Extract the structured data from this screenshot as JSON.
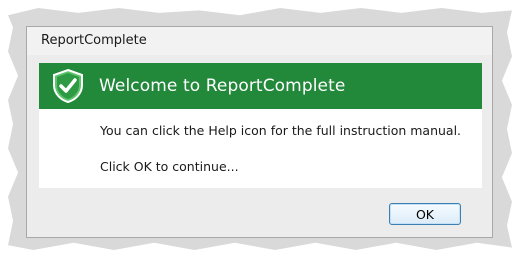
{
  "window": {
    "title": "ReportComplete"
  },
  "banner": {
    "icon": "shield-check-icon",
    "title": "Welcome to ReportComplete",
    "color": "#22883a"
  },
  "message": {
    "line1": "You can click the Help icon for the full instruction manual.",
    "line2": "Click OK to continue..."
  },
  "buttons": {
    "ok_label": "OK"
  }
}
